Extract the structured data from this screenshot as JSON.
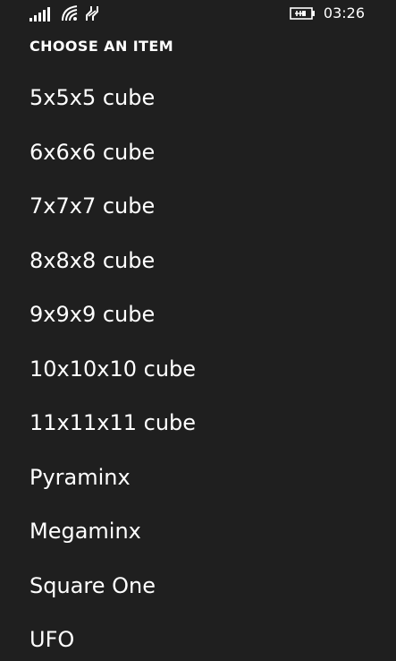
{
  "status_bar": {
    "icons": [
      "signal-strength-icon",
      "wifi-icon",
      "data-connection-icon",
      "battery-charging-icon"
    ],
    "time": "03:26"
  },
  "picker": {
    "title": "CHOOSE AN ITEM",
    "items": [
      {
        "label": "5x5x5 cube"
      },
      {
        "label": "6x6x6 cube"
      },
      {
        "label": "7x7x7 cube"
      },
      {
        "label": "8x8x8 cube"
      },
      {
        "label": "9x9x9 cube"
      },
      {
        "label": "10x10x10 cube"
      },
      {
        "label": "11x11x11 cube"
      },
      {
        "label": "Pyraminx"
      },
      {
        "label": "Megaminx"
      },
      {
        "label": "Square One"
      },
      {
        "label": "UFO"
      }
    ]
  },
  "colors": {
    "background": "#1f1f1f",
    "text": "#ffffff"
  }
}
